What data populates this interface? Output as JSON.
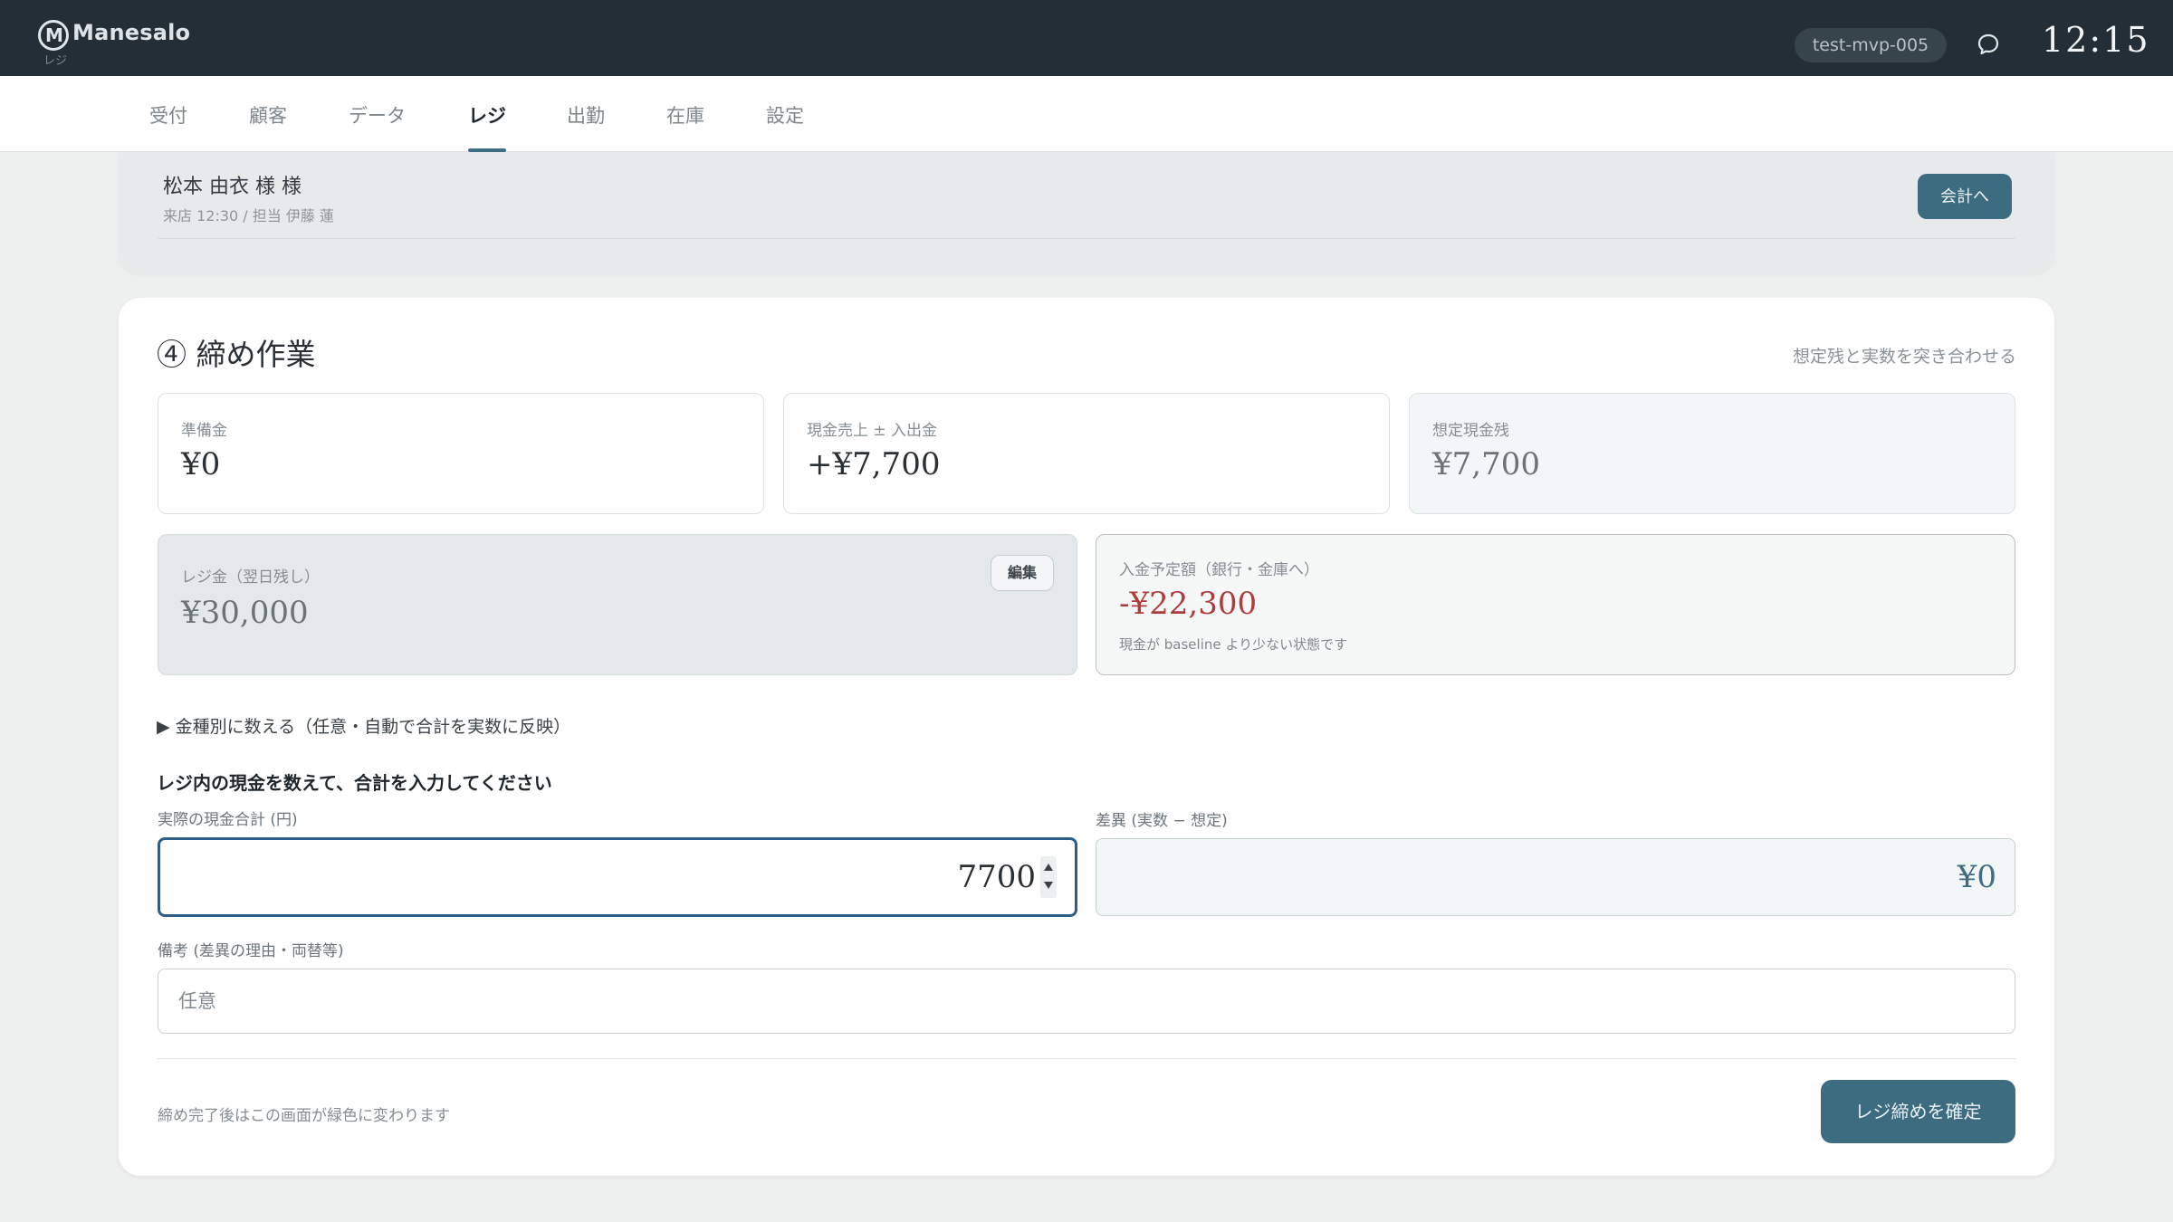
{
  "app": {
    "brand": "Manesalo",
    "brand_sub": "レジ",
    "user": "test-mvp-005",
    "clock": "12:15"
  },
  "nav": {
    "tabs": [
      "受付",
      "顧客",
      "データ",
      "レジ",
      "出勤",
      "在庫",
      "設定"
    ],
    "active": "レジ"
  },
  "previous": {
    "customer": "松本 由衣 様 様",
    "meta": "来店 12:30 / 担当 伊藤 蓮",
    "checkout_label": "会計へ"
  },
  "closing": {
    "title": "④ 締め作業",
    "hint": "想定残と実数を突き合わせる",
    "float_label": "準備金",
    "float_value": "¥0",
    "cash_sales_label": "現金売上 ± 入出金",
    "cash_sales_value": "+¥7,700",
    "expected_label": "想定現金残",
    "expected_value": "¥7,700",
    "register_label": "レジ金（翌日残し）",
    "register_value": "¥30,000",
    "edit_label": "編集",
    "deposit_label": "入金予定額（銀行・金庫へ）",
    "deposit_value": "-¥22,300",
    "deposit_note": "現金が baseline より少ない状態です",
    "denomination_toggle": "▶ 金種別に数える（任意・自動で合計を実数に反映）",
    "count_heading": "レジ内の現金を数えて、合計を入力してください",
    "actual_label": "実際の現金合計 (円)",
    "actual_value": "7700",
    "diff_label": "差異 (実数 − 想定)",
    "diff_value": "¥0",
    "memo_label": "備考 (差異の理由・両替等)",
    "memo_placeholder": "任意",
    "footer_note": "締め完了後はこの画面が緑色に変わります",
    "confirm_label": "レジ締めを確定"
  },
  "colors": {
    "topbar": "#232e36",
    "accent": "#3d6b80",
    "negative": "#b03c3c",
    "focus": "#2b5f8a"
  }
}
